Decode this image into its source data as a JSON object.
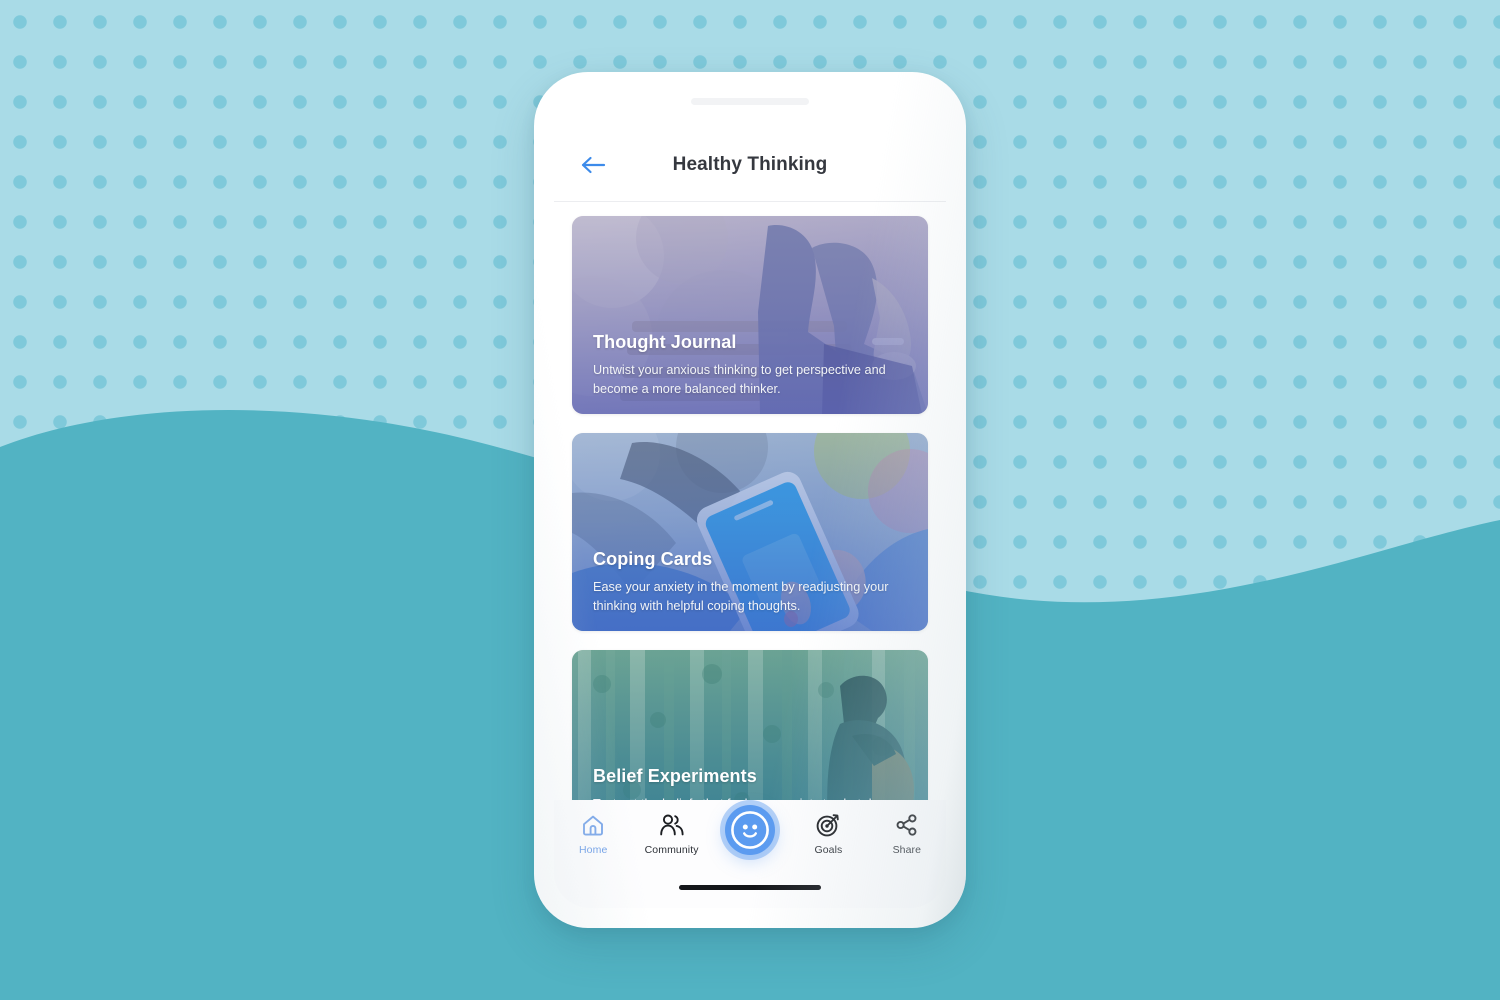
{
  "background": {
    "base_color": "#a9dbe7",
    "dot_color": "#7fc9da",
    "wave_color": "#52b3c3"
  },
  "phone": {
    "frame_color": "#ffffff",
    "speaker_name": "phone-speaker",
    "home_indicator_name": "home-indicator"
  },
  "appbar": {
    "back_icon": "arrow-left-icon",
    "back_icon_color": "#3d8bea",
    "title": "Healthy Thinking",
    "title_color": "#35383f"
  },
  "cards": [
    {
      "id": "thought-journal",
      "title": "Thought Journal",
      "description": "Untwist your anxious thinking to get perspective and become a more balanced thinker.",
      "photo": "person-sitting-on-bench",
      "tint_color": "#6a6fb0",
      "accent_color": "#8a8fc4"
    },
    {
      "id": "coping-cards",
      "title": "Coping Cards",
      "description": "Ease your anxiety in the moment by readjusting your thinking with helpful coping thoughts.",
      "photo": "hand-holding-smartphone",
      "tint_color": "#4c6fc0",
      "accent_color": "#30a7e8"
    },
    {
      "id": "belief-experiments",
      "title": "Belief Experiments",
      "description": "Test out the beliefs that fuel your anxiety to shut down excessive worry for good.",
      "photo": "hiker-in-forest",
      "tint_color": "#3e8a97",
      "accent_color": "#4d8f84"
    }
  ],
  "bottom_nav": {
    "items": [
      {
        "label": "Home",
        "icon": "home-icon",
        "active": true
      },
      {
        "label": "Community",
        "icon": "people-icon",
        "active": false
      },
      {
        "label": "Goals",
        "icon": "target-icon",
        "active": false
      },
      {
        "label": "Share",
        "icon": "share-icon",
        "active": false
      }
    ],
    "center_button": {
      "icon": "smiley-face-icon",
      "color": "#5b9bf0",
      "halo_color": "#7caef3"
    },
    "active_color": "#6f9fe8",
    "inactive_color": "#2e3238"
  }
}
